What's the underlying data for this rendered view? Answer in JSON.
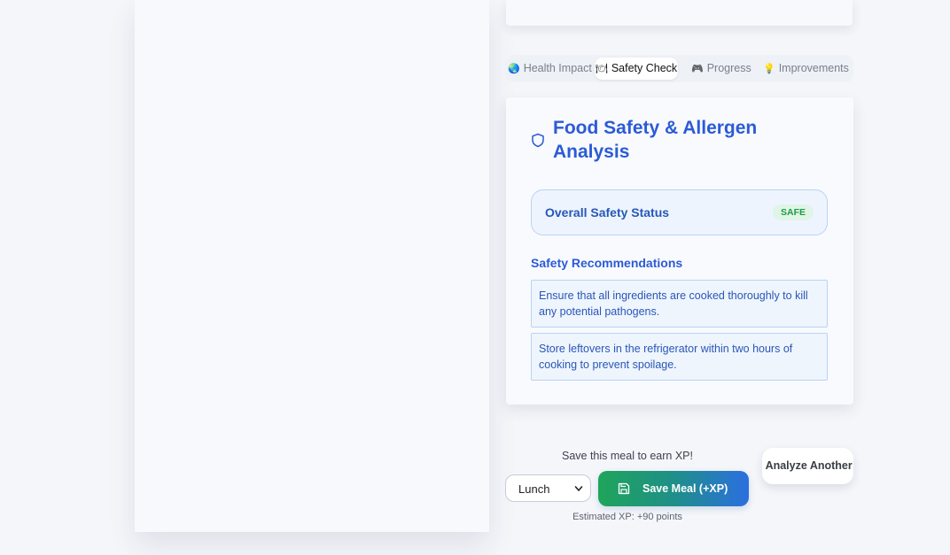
{
  "tabs": [
    {
      "icon": "🌏",
      "label": "Health Impact"
    },
    {
      "icon": "🍽",
      "label": "Safety Check"
    },
    {
      "icon": "🎮",
      "label": "Progress"
    },
    {
      "icon": "💡",
      "label": "Improvements"
    }
  ],
  "active_tab": "Safety Check",
  "safety": {
    "title": "Food Safety & Allergen Analysis",
    "status_label": "Overall Safety Status",
    "status_badge": "SAFE",
    "recommendations_title": "Safety Recommendations",
    "recommendations": [
      "Ensure that all ingredients are cooked thoroughly to kill any potential pathogens.",
      "Store leftovers in the refrigerator within two hours of cooking to prevent spoilage."
    ]
  },
  "save": {
    "prompt": "Save this meal to earn XP!",
    "meal_type_selected": "Lunch",
    "save_button_label": "Save Meal (+XP)",
    "estimated_xp": "Estimated XP: +90 points",
    "analyze_another_label": "Analyze Another Meal"
  },
  "colors": {
    "accent_blue": "#2b5bd6",
    "safe_green": "#1e9a4a",
    "save_gradient_start": "#1fa55a",
    "save_gradient_end": "#2b6fe0"
  }
}
